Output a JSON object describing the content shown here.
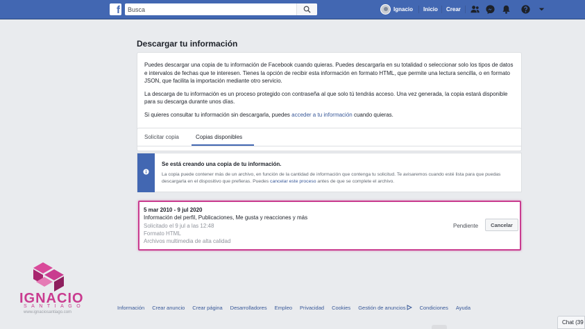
{
  "topbar": {
    "search_placeholder": "Busca",
    "profile_name": "Ignacio",
    "nav_home": "Inicio",
    "nav_create": "Crear",
    "logo_letter": "f"
  },
  "page": {
    "title": "Descargar tu información"
  },
  "intro": {
    "p1": "Puedes descargar una copia de tu información de Facebook cuando quieras. Puedes descargarla en su totalidad o seleccionar solo los tipos de datos e intervalos de fechas que te interesen. Tienes la opción de recibir esta información en formato HTML, que permite una lectura sencilla, o en formato JSON, que facilita la importación mediante otro servicio.",
    "p2": "La descarga de tu información es un proceso protegido con contraseña al que solo tú tendrás acceso. Una vez generada, la copia estará disponible para su descarga durante unos días.",
    "p3_before": "Si quieres consultar tu información sin descargarla, puedes ",
    "p3_link": "acceder a tu información",
    "p3_after": " cuando quieras."
  },
  "tabs": [
    {
      "label": "Solicitar copia"
    },
    {
      "label": "Copias disponibles"
    }
  ],
  "notice": {
    "title": "Se está creando una copia de tu información.",
    "body_before": "La copia puede contener más de un archivo, en función de la cantidad de información que contenga tu solicitud. Te avisaremos cuando esté lista para que puedas descargarla en el dispositivo que prefieras. Puedes ",
    "body_link": "cancelar este proceso",
    "body_after": " antes de que se complete el archivo."
  },
  "copy": {
    "dates": "5 mar 2010 - 9 jul 2020",
    "content": "Información del perfil, Publicaciones, Me gusta y reacciones y más",
    "requested": "Solicitado el 9 jul a las 12:48",
    "format": "Formato HTML",
    "media": "Archivos multimedia de alta calidad",
    "status": "Pendiente",
    "cancel_label": "Cancelar"
  },
  "watermark": {
    "name": "IGNACIO",
    "sub": "SANTIAGO",
    "url": "www.ignaciosantiago.com"
  },
  "footer": {
    "links": [
      "Información",
      "Crear anuncio",
      "Crear página",
      "Desarrolladores",
      "Empleo",
      "Privacidad",
      "Cookies",
      "Gestión de anuncios",
      "Condiciones",
      "Ayuda"
    ]
  },
  "chat": {
    "label": "Chat (39"
  },
  "colors": {
    "brand": "#4267b2",
    "highlight": "#c93b8f",
    "link": "#385898"
  }
}
